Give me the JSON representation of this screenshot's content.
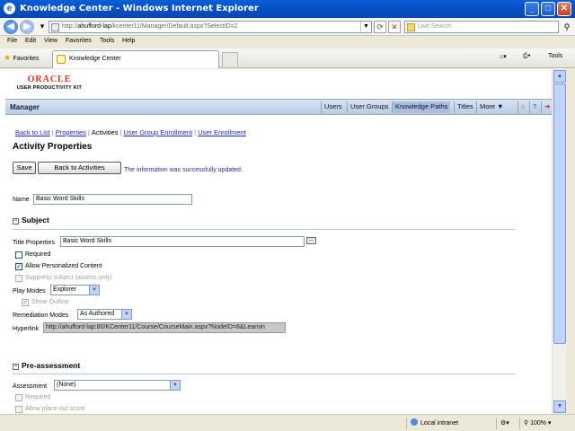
{
  "window": {
    "title": "Knowledge Center - Windows Internet Explorer",
    "minimize_glyph": "_",
    "maximize_glyph": "□",
    "close_glyph": "✕"
  },
  "address": {
    "url_prefix": "http://",
    "url_host": "ahufford-lap",
    "url_rest": "/kcenter11/Manager/Default.aspx?SelectID=2",
    "search_placeholder": "Live Search"
  },
  "menu": [
    "File",
    "Edit",
    "View",
    "Favorites",
    "Tools",
    "Help"
  ],
  "favbar": {
    "favorites_label": "Favorites",
    "tab_label": "Knowledge Center",
    "tools_label": "Tools"
  },
  "brand": {
    "oracle": "ORACLE",
    "product": "USER PRODUCTIVITY KIT"
  },
  "header": {
    "title": "Manager",
    "tabs": [
      "Users",
      "User Groups",
      "Knowledge Paths",
      "Titles",
      "More ▼"
    ],
    "active_tab": "Knowledge Paths"
  },
  "subnav": {
    "back": "Back to List",
    "properties": "Properties",
    "activities": "Activities",
    "group_enrollment": "User Group Enrollment",
    "user_enrollment": "User Enrollment"
  },
  "page": {
    "title": "Activity Properties",
    "save": "Save",
    "back_to_activities": "Back to Activities",
    "success": "The information was successfully updated."
  },
  "form": {
    "name_label": "Name",
    "name_value": "Basic Word Skills",
    "subject_heading": "Subject",
    "title_properties_label": "Title Properties",
    "title_properties_value": "Basic Word Skills",
    "required_label": "Required",
    "allow_personalized_label": "Allow Personalized Content",
    "suppress_label": "Suppress subject (assess only)",
    "play_modes_label": "Play Modes",
    "play_modes_value": "Explorer",
    "show_outline_label": "Show Outline",
    "remediation_label": "Remediation Modes",
    "remediation_value": "As Authored",
    "hyperlink_label": "Hyperlink",
    "hyperlink_value": "http://ahufford-lap:80/KCenter11/Course/CourseMain.aspx?NodeID=8&Learnin",
    "preassessment_heading": "Pre-assessment",
    "assessment_label": "Assessment",
    "assessment_value": "(None)",
    "pre_required_label": "Required",
    "allow_placeout_label": "Allow place-out score",
    "section_toggle": "−",
    "checkmark": "✓",
    "dots": "..."
  },
  "status": {
    "zone": "Local intranet",
    "zoom": "100%"
  }
}
